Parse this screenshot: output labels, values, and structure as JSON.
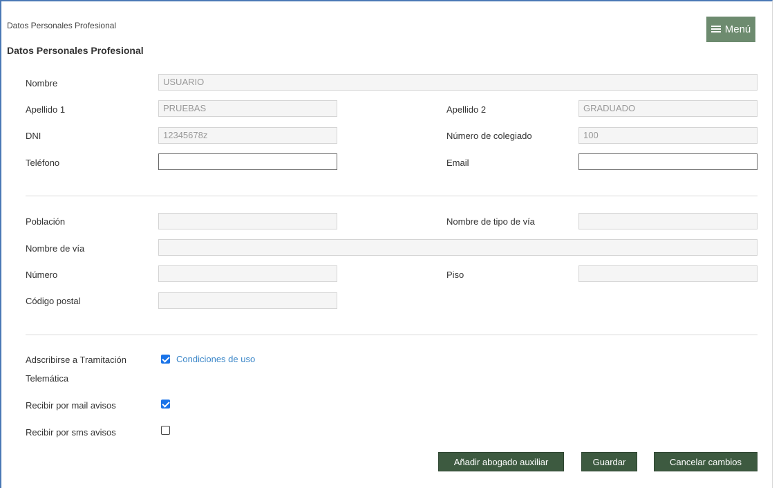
{
  "breadcrumb": "Datos Personales Profesional",
  "menu_label": "Menú",
  "page_title": "Datos Personales Profesional",
  "personal": {
    "nombre": {
      "label": "Nombre",
      "value": "USUARIO"
    },
    "apellido1": {
      "label": "Apellido 1",
      "value": "PRUEBAS"
    },
    "apellido2": {
      "label": "Apellido 2",
      "value": "GRADUADO"
    },
    "dni": {
      "label": "DNI",
      "value": "12345678z"
    },
    "colegiado": {
      "label": "Número de colegiado",
      "value": "100"
    },
    "telefono": {
      "label": "Teléfono",
      "value": ""
    },
    "email": {
      "label": "Email",
      "value": ""
    }
  },
  "address": {
    "poblacion": {
      "label": "Población",
      "value": ""
    },
    "tipo_via": {
      "label": "Nombre de tipo de vía",
      "value": ""
    },
    "nombre_via": {
      "label": "Nombre de vía",
      "value": ""
    },
    "numero": {
      "label": "Número",
      "value": ""
    },
    "piso": {
      "label": "Piso",
      "value": ""
    },
    "codigo_postal": {
      "label": "Código postal",
      "value": ""
    }
  },
  "options": {
    "tramitacion": {
      "label_line1": "Adscribirse a Tramitación",
      "label_line2": "Telemática",
      "checked": true,
      "link": "Condiciones de uso"
    },
    "mail": {
      "label": "Recibir por mail avisos",
      "checked": true
    },
    "sms": {
      "label": "Recibir por sms avisos",
      "checked": false
    }
  },
  "buttons": {
    "add_auxiliar": "Añadir abogado auxiliar",
    "save": "Guardar",
    "cancel": "Cancelar cambios"
  },
  "colors": {
    "menu_bg": "#6d8b6f",
    "button_bg": "#3d5a40",
    "link": "#3a86c8",
    "checkbox": "#1a73e8"
  },
  "icons": {
    "menu": "hamburger-icon",
    "checkbox_checked": "checkbox-checked-icon",
    "checkbox_unchecked": "checkbox-unchecked-icon"
  }
}
